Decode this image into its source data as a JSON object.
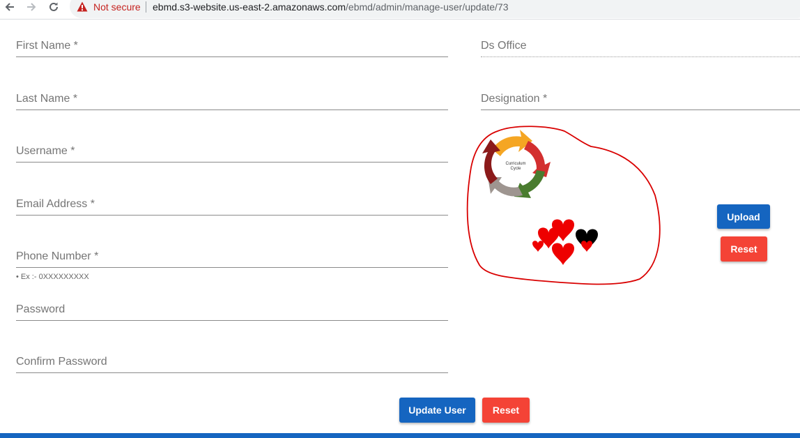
{
  "browser": {
    "security_label": "Not secure",
    "url_host": "ebmd.s3-website.us-east-2.amazonaws.com",
    "url_path": "/ebmd/admin/manage-user/update/73"
  },
  "form": {
    "first_name_label": "First Name *",
    "last_name_label": "Last Name *",
    "username_label": "Username *",
    "email_label": "Email Address *",
    "phone_label": "Phone Number *",
    "phone_hint": "• Ex :- 0XXXXXXXXX",
    "password_label": "Password",
    "confirm_password_label": "Confirm Password",
    "ds_office_label": "Ds Office",
    "designation_label": "Designation *"
  },
  "image": {
    "cycle_text_line1": "Curriculum",
    "cycle_text_line2": "Cycle",
    "cycle_colors": [
      "#f5a623",
      "#d32f2f",
      "#4a7c2f",
      "#9e9590",
      "#8b1a1a"
    ],
    "heart_colors": [
      "#ee0000",
      "#000000"
    ],
    "outline_color": "#d90000"
  },
  "buttons": {
    "upload": "Upload",
    "image_reset": "Reset",
    "update_user": "Update User",
    "form_reset": "Reset"
  },
  "colors": {
    "primary": "#1565c0",
    "danger": "#f44336",
    "warning_text": "#c5221f"
  }
}
